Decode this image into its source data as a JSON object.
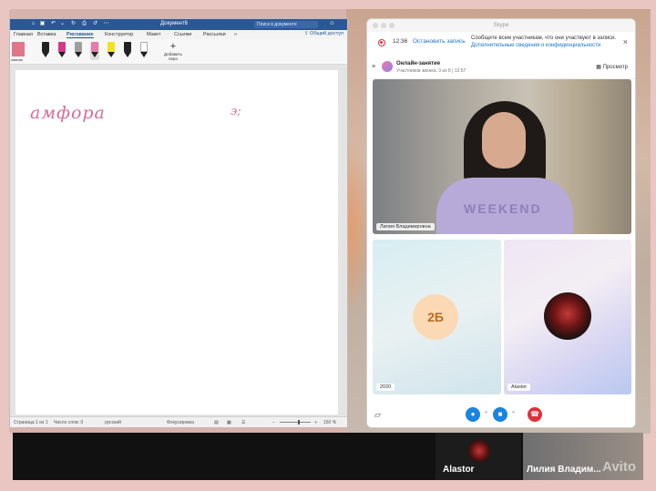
{
  "word": {
    "title": "Документ6",
    "search_placeholder": "Поиск в документе",
    "tabs": [
      "Главная",
      "Вставка",
      "Рисование",
      "Конструктор",
      "Макет",
      "Ссылки",
      "Рассылки",
      "»"
    ],
    "share": "Общий доступ",
    "ribbon": {
      "left_label": "ование",
      "add_pen": "Добавить перо"
    },
    "pens": [
      {
        "color": "#222222"
      },
      {
        "color": "#d33a8a"
      },
      {
        "color": "#9e9e9e"
      },
      {
        "color": "#e57ba8"
      },
      {
        "color": "#f4e21e"
      },
      {
        "color": "#222222"
      },
      {
        "color": "#222222"
      }
    ],
    "handwriting": [
      "амфора",
      "э;"
    ],
    "status": {
      "page": "Страница 1 из 1",
      "words": "Число слов: 0",
      "language": "русский",
      "focus": "Фокусировка",
      "zoom": "160 %",
      "zoom_fraction": 0.6
    }
  },
  "skype": {
    "window_title": "Skype",
    "recording": {
      "time": "12:36",
      "stop_label": "Остановить запись",
      "message": "Сообщите всем участникам, что они участвуют в записи.",
      "link": "Дополнительные сведения о конфиденциальности"
    },
    "meeting": {
      "title": "Онлайн-занятие",
      "subtitle": "Участников звонка: 3 из 8 | 13:57",
      "view_label": "Просмотр"
    },
    "participants": [
      {
        "name": "Лилия Владимировна",
        "shirt": "WEEKEND"
      },
      {
        "name": "2020",
        "badge": "2Б"
      },
      {
        "name": "Alastor"
      }
    ]
  },
  "strip": {
    "items": [
      "Alastor",
      "Лилия Владим..."
    ],
    "watermark": "Avito"
  }
}
